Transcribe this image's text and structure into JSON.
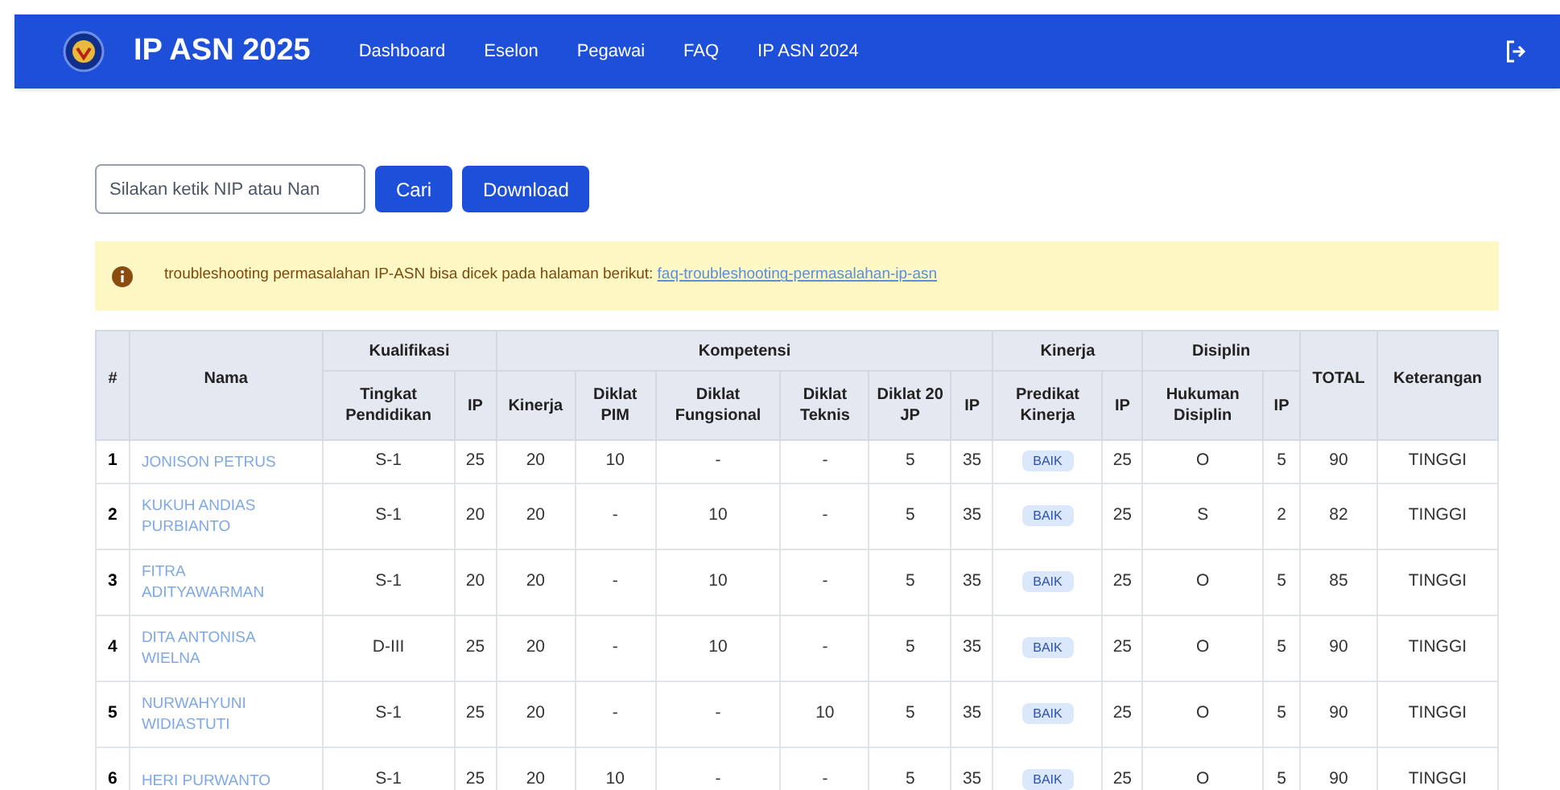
{
  "navbar": {
    "title": "IP ASN 2025",
    "links": [
      "Dashboard",
      "Eselon",
      "Pegawai",
      "FAQ",
      "IP ASN 2024"
    ]
  },
  "search": {
    "placeholder": "Silakan ketik NIP atau Nan",
    "buttons": [
      "Cari",
      "Download"
    ]
  },
  "alert": {
    "text": "troubleshooting permasalahan IP-ASN bisa dicek pada halaman berikut:",
    "link": "faq-troubleshooting-permasalahan-ip-asn"
  },
  "table": {
    "columns": [
      {
        "label": "#"
      },
      {
        "label": "Nama"
      },
      {
        "group": "Kualifikasi",
        "columns": [
          {
            "label": "Tingkat Pendidikan"
          },
          {
            "label": "IP"
          }
        ]
      },
      {
        "group": "Kompetensi",
        "columns": [
          {
            "label": "Kinerja"
          },
          {
            "label": "Diklat PIM"
          },
          {
            "label": "Diklat Fungsional"
          },
          {
            "label": "Diklat Teknis"
          },
          {
            "label": "Diklat 20 JP"
          },
          {
            "label": "IP"
          }
        ]
      },
      {
        "group": "Kinerja",
        "columns": [
          {
            "label": "Predikat Kinerja",
            "kind": "badge"
          },
          {
            "label": "IP"
          }
        ]
      },
      {
        "group": "Disiplin",
        "columns": [
          {
            "label": "Hukuman Disiplin"
          },
          {
            "label": "IP"
          }
        ]
      },
      {
        "label": "TOTAL"
      },
      {
        "label": "Keterangan"
      }
    ],
    "rows": [
      {
        "number": "1",
        "name": "JONISON PETRUS",
        "values": [
          "S-1",
          "25",
          "20",
          "10",
          "-",
          "-",
          "5",
          "35",
          "BAIK",
          "25",
          "O",
          "5",
          "90",
          "TINGGI"
        ]
      },
      {
        "number": "2",
        "name": "KUKUH ANDIAS PURBIANTO",
        "values": [
          "S-1",
          "20",
          "20",
          "-",
          "10",
          "-",
          "5",
          "35",
          "BAIK",
          "25",
          "S",
          "2",
          "82",
          "TINGGI"
        ]
      },
      {
        "number": "3",
        "name": "FITRA ADITYAWARMAN",
        "values": [
          "S-1",
          "20",
          "20",
          "-",
          "10",
          "-",
          "5",
          "35",
          "BAIK",
          "25",
          "O",
          "5",
          "85",
          "TINGGI"
        ]
      },
      {
        "number": "4",
        "name": "DITA ANTONISA WIELNA",
        "values": [
          "D-III",
          "25",
          "20",
          "-",
          "10",
          "-",
          "5",
          "35",
          "BAIK",
          "25",
          "O",
          "5",
          "90",
          "TINGGI"
        ]
      },
      {
        "number": "5",
        "name": "NURWAHYUNI WIDIASTUTI",
        "values": [
          "S-1",
          "25",
          "20",
          "-",
          "-",
          "10",
          "5",
          "35",
          "BAIK",
          "25",
          "O",
          "5",
          "90",
          "TINGGI"
        ]
      },
      {
        "number": "6",
        "name": "HERI PURWANTO",
        "values": [
          "S-1",
          "25",
          "20",
          "10",
          "-",
          "-",
          "5",
          "35",
          "BAIK",
          "25",
          "O",
          "5",
          "90",
          "TINGGI"
        ]
      }
    ]
  }
}
